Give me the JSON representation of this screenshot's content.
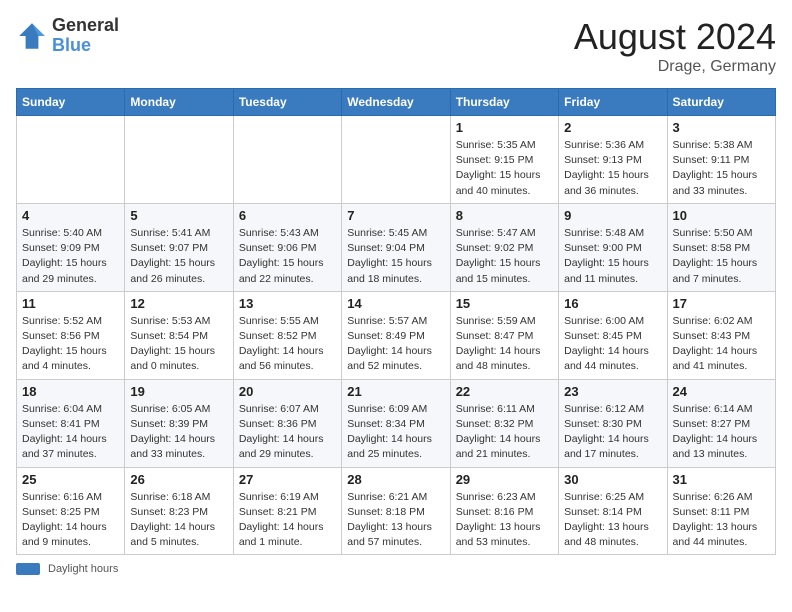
{
  "header": {
    "logo_line1": "General",
    "logo_line2": "Blue",
    "month": "August 2024",
    "location": "Drage, Germany"
  },
  "weekdays": [
    "Sunday",
    "Monday",
    "Tuesday",
    "Wednesday",
    "Thursday",
    "Friday",
    "Saturday"
  ],
  "weeks": [
    [
      {
        "day": "",
        "info": ""
      },
      {
        "day": "",
        "info": ""
      },
      {
        "day": "",
        "info": ""
      },
      {
        "day": "",
        "info": ""
      },
      {
        "day": "1",
        "info": "Sunrise: 5:35 AM\nSunset: 9:15 PM\nDaylight: 15 hours and 40 minutes."
      },
      {
        "day": "2",
        "info": "Sunrise: 5:36 AM\nSunset: 9:13 PM\nDaylight: 15 hours and 36 minutes."
      },
      {
        "day": "3",
        "info": "Sunrise: 5:38 AM\nSunset: 9:11 PM\nDaylight: 15 hours and 33 minutes."
      }
    ],
    [
      {
        "day": "4",
        "info": "Sunrise: 5:40 AM\nSunset: 9:09 PM\nDaylight: 15 hours and 29 minutes."
      },
      {
        "day": "5",
        "info": "Sunrise: 5:41 AM\nSunset: 9:07 PM\nDaylight: 15 hours and 26 minutes."
      },
      {
        "day": "6",
        "info": "Sunrise: 5:43 AM\nSunset: 9:06 PM\nDaylight: 15 hours and 22 minutes."
      },
      {
        "day": "7",
        "info": "Sunrise: 5:45 AM\nSunset: 9:04 PM\nDaylight: 15 hours and 18 minutes."
      },
      {
        "day": "8",
        "info": "Sunrise: 5:47 AM\nSunset: 9:02 PM\nDaylight: 15 hours and 15 minutes."
      },
      {
        "day": "9",
        "info": "Sunrise: 5:48 AM\nSunset: 9:00 PM\nDaylight: 15 hours and 11 minutes."
      },
      {
        "day": "10",
        "info": "Sunrise: 5:50 AM\nSunset: 8:58 PM\nDaylight: 15 hours and 7 minutes."
      }
    ],
    [
      {
        "day": "11",
        "info": "Sunrise: 5:52 AM\nSunset: 8:56 PM\nDaylight: 15 hours and 4 minutes."
      },
      {
        "day": "12",
        "info": "Sunrise: 5:53 AM\nSunset: 8:54 PM\nDaylight: 15 hours and 0 minutes."
      },
      {
        "day": "13",
        "info": "Sunrise: 5:55 AM\nSunset: 8:52 PM\nDaylight: 14 hours and 56 minutes."
      },
      {
        "day": "14",
        "info": "Sunrise: 5:57 AM\nSunset: 8:49 PM\nDaylight: 14 hours and 52 minutes."
      },
      {
        "day": "15",
        "info": "Sunrise: 5:59 AM\nSunset: 8:47 PM\nDaylight: 14 hours and 48 minutes."
      },
      {
        "day": "16",
        "info": "Sunrise: 6:00 AM\nSunset: 8:45 PM\nDaylight: 14 hours and 44 minutes."
      },
      {
        "day": "17",
        "info": "Sunrise: 6:02 AM\nSunset: 8:43 PM\nDaylight: 14 hours and 41 minutes."
      }
    ],
    [
      {
        "day": "18",
        "info": "Sunrise: 6:04 AM\nSunset: 8:41 PM\nDaylight: 14 hours and 37 minutes."
      },
      {
        "day": "19",
        "info": "Sunrise: 6:05 AM\nSunset: 8:39 PM\nDaylight: 14 hours and 33 minutes."
      },
      {
        "day": "20",
        "info": "Sunrise: 6:07 AM\nSunset: 8:36 PM\nDaylight: 14 hours and 29 minutes."
      },
      {
        "day": "21",
        "info": "Sunrise: 6:09 AM\nSunset: 8:34 PM\nDaylight: 14 hours and 25 minutes."
      },
      {
        "day": "22",
        "info": "Sunrise: 6:11 AM\nSunset: 8:32 PM\nDaylight: 14 hours and 21 minutes."
      },
      {
        "day": "23",
        "info": "Sunrise: 6:12 AM\nSunset: 8:30 PM\nDaylight: 14 hours and 17 minutes."
      },
      {
        "day": "24",
        "info": "Sunrise: 6:14 AM\nSunset: 8:27 PM\nDaylight: 14 hours and 13 minutes."
      }
    ],
    [
      {
        "day": "25",
        "info": "Sunrise: 6:16 AM\nSunset: 8:25 PM\nDaylight: 14 hours and 9 minutes."
      },
      {
        "day": "26",
        "info": "Sunrise: 6:18 AM\nSunset: 8:23 PM\nDaylight: 14 hours and 5 minutes."
      },
      {
        "day": "27",
        "info": "Sunrise: 6:19 AM\nSunset: 8:21 PM\nDaylight: 14 hours and 1 minute."
      },
      {
        "day": "28",
        "info": "Sunrise: 6:21 AM\nSunset: 8:18 PM\nDaylight: 13 hours and 57 minutes."
      },
      {
        "day": "29",
        "info": "Sunrise: 6:23 AM\nSunset: 8:16 PM\nDaylight: 13 hours and 53 minutes."
      },
      {
        "day": "30",
        "info": "Sunrise: 6:25 AM\nSunset: 8:14 PM\nDaylight: 13 hours and 48 minutes."
      },
      {
        "day": "31",
        "info": "Sunrise: 6:26 AM\nSunset: 8:11 PM\nDaylight: 13 hours and 44 minutes."
      }
    ]
  ],
  "footer": {
    "label": "Daylight hours"
  }
}
